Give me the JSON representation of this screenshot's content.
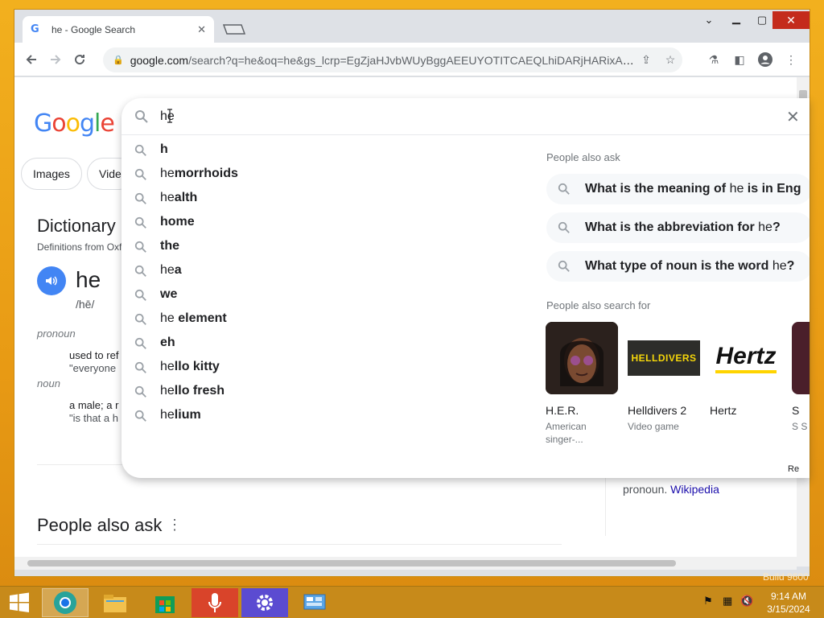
{
  "browser": {
    "tab_title": "he - Google Search",
    "url_host": "google.com",
    "url_rest": "/search?q=he&oq=he&gs_lcrp=EgZjaHJvbWUyBggAEEUYOTITCAEQLhiDARjHARixAxjRAxi..."
  },
  "page": {
    "logo": [
      "G",
      "o",
      "o",
      "g",
      "l",
      "e"
    ],
    "chips": [
      "Images",
      "Vide"
    ],
    "dictionary_heading": "Dictionary",
    "definitions_from": "Definitions from Oxf",
    "word": "he",
    "phonetic": "/hē/",
    "pos1": "pronoun",
    "def1": "used to ref",
    "ex1": "\"everyone",
    "pos2": "noun",
    "def2": "a male; a r",
    "ex2": "\"is that a h",
    "people_also_ask": "People also ask",
    "wiki_prefix": "pronoun.",
    "wiki_link": "Wikipedia"
  },
  "search": {
    "query": "he",
    "suggestions": [
      {
        "pre": "",
        "bold": "h"
      },
      {
        "pre": "he",
        "bold": "morrhoids"
      },
      {
        "pre": "he",
        "bold": "alth"
      },
      {
        "pre": "",
        "bold": "home"
      },
      {
        "pre": "",
        "bold": "the"
      },
      {
        "pre": "he",
        "bold": "a"
      },
      {
        "pre": "",
        "bold": "we"
      },
      {
        "pre": "he ",
        "bold": "element"
      },
      {
        "pre": "",
        "bold": "eh"
      },
      {
        "pre": "he",
        "bold": "llo kitty"
      },
      {
        "pre": "he",
        "bold": "llo fresh"
      },
      {
        "pre": "he",
        "bold": "lium"
      }
    ],
    "people_also_ask_label": "People also ask",
    "questions": [
      {
        "b1": "What is the meaning of ",
        "n": "he",
        "b2": " is in Eng"
      },
      {
        "b1": "What is the abbreviation for ",
        "n": "he",
        "b2": "?"
      },
      {
        "b1": "What type of noun is the word ",
        "n": "he",
        "b2": "?"
      }
    ],
    "people_also_search_label": "People also search for",
    "cards": [
      {
        "name": "H.E.R.",
        "desc": "American singer-..."
      },
      {
        "name": "Helldivers 2",
        "desc": "Video game",
        "img_text": "HELLDIVERS"
      },
      {
        "name": "Hertz",
        "desc": "",
        "img_text": "Hertz"
      },
      {
        "name": "S",
        "desc": "S S"
      }
    ],
    "report": "Re"
  },
  "taskbar": {
    "time": "9:14 AM",
    "date": "3/15/2024",
    "build_text": "Build 9600"
  },
  "colors": {
    "google_blue": "#4285f4",
    "google_red": "#ea4335",
    "google_yellow": "#fbbc05",
    "google_green": "#34a853",
    "desktop": "#e8a418"
  }
}
